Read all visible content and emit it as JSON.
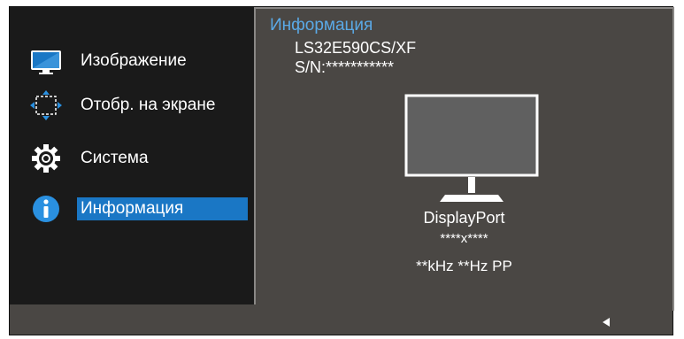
{
  "menu": {
    "items": [
      {
        "label": "Изображение",
        "icon": "picture-icon",
        "selected": false
      },
      {
        "label": "Отобр. на экране",
        "icon": "onscreen-display-icon",
        "selected": false
      },
      {
        "label": "Система",
        "icon": "gear-icon",
        "selected": false
      },
      {
        "label": "Информация",
        "icon": "info-icon",
        "selected": true
      }
    ]
  },
  "info_panel": {
    "title": "Информация",
    "model": "LS32E590CS/XF",
    "serial": "S/N:***********",
    "input_source": "DisplayPort",
    "resolution": "****x****",
    "frequency": "**kHz **Hz PP",
    "image": "monitor-icon"
  },
  "footer": {
    "nav_icon": "arrow-left-icon"
  },
  "colors": {
    "accent": "#1a77c5",
    "title_blue": "#5aa9e6",
    "menu_bg": "#1a1a1a",
    "panel_bg": "#4a4744",
    "panel_border": "#8a8886"
  }
}
